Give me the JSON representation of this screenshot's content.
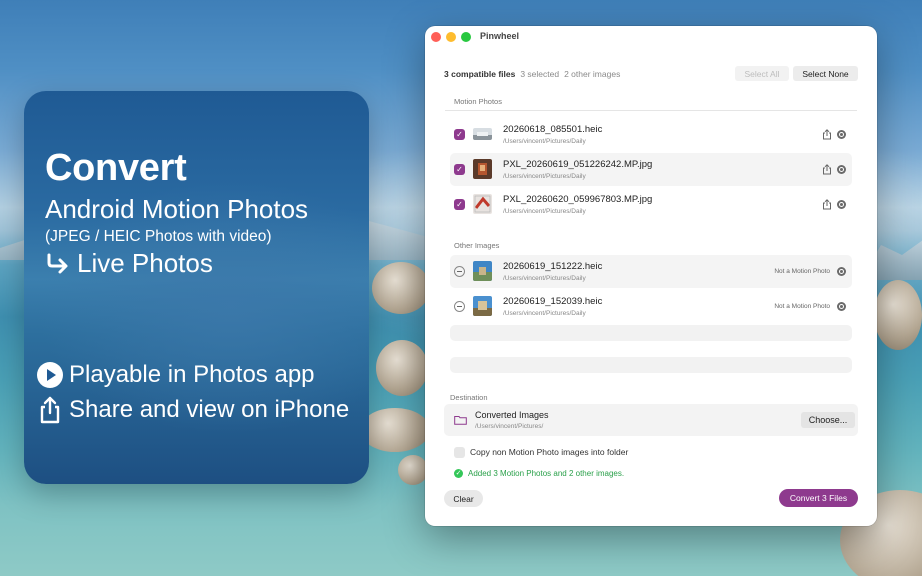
{
  "promo": {
    "title": "Convert",
    "subtitle": "Android Motion Photos",
    "small": "(JPEG / HEIC Photos with video)",
    "live": "Live Photos",
    "feature1": "Playable in Photos app",
    "feature2": "Share and view on iPhone"
  },
  "window": {
    "title": "Pinwheel",
    "summary": {
      "compatible": "3 compatible files",
      "selected": "3 selected",
      "other": "2 other images"
    },
    "select_all": "Select All",
    "select_none": "Select None",
    "motion_label": "Motion Photos",
    "motion_photos": [
      {
        "name": "20260618_085501.heic",
        "path": "/Users/vincent/Pictures/Daily"
      },
      {
        "name": "PXL_20260619_051226242.MP.jpg",
        "path": "/Users/vincent/Pictures/Daily"
      },
      {
        "name": "PXL_20260620_059967803.MP.jpg",
        "path": "/Users/vincent/Pictures/Daily"
      }
    ],
    "other_label": "Other Images",
    "other_images": [
      {
        "name": "20260619_151222.heic",
        "path": "/Users/vincent/Pictures/Daily",
        "status": "Not a Motion Photo"
      },
      {
        "name": "20260619_152039.heic",
        "path": "/Users/vincent/Pictures/Daily",
        "status": "Not a Motion Photo"
      }
    ],
    "destination_label": "Destination",
    "destination": {
      "name": "Converted Images",
      "path": "/Users/vincent/Pictures/"
    },
    "choose": "Choose...",
    "copy_label": "Copy non Motion Photo images into folder",
    "status_text": "Added 3 Motion Photos and 2 other images.",
    "clear": "Clear",
    "convert": "Convert 3 Files"
  },
  "colors": {
    "accent": "#8e3a8e",
    "success": "#34c759"
  }
}
